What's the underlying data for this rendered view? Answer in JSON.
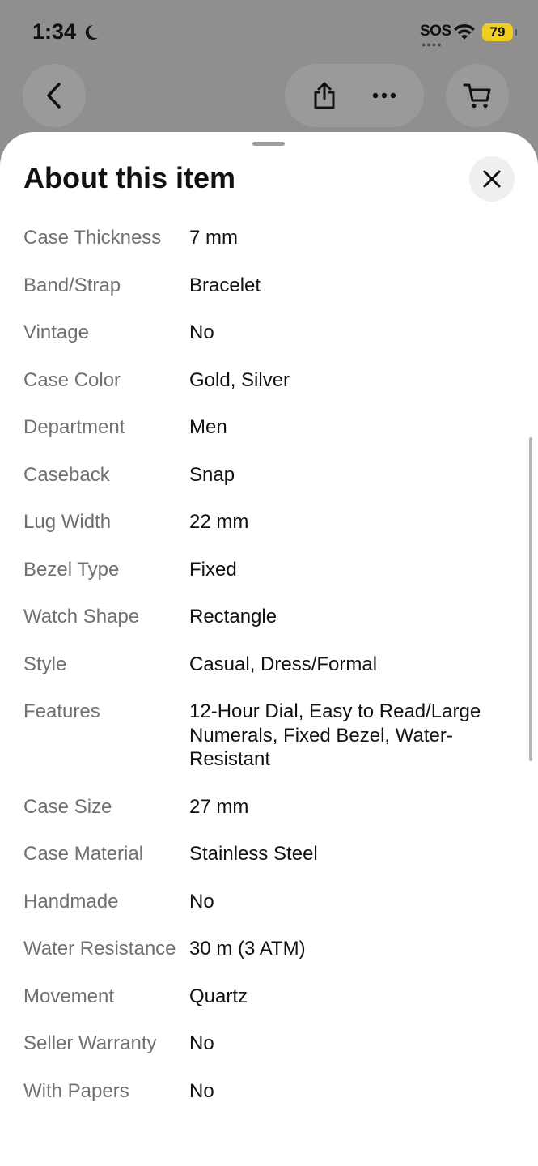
{
  "status_bar": {
    "time": "1:34",
    "sos": "SOS",
    "battery": "79"
  },
  "sheet": {
    "title": "About this item"
  },
  "specs": [
    {
      "label": "Case Thickness",
      "value": "7 mm"
    },
    {
      "label": "Band/Strap",
      "value": "Bracelet"
    },
    {
      "label": "Vintage",
      "value": "No"
    },
    {
      "label": "Case Color",
      "value": "Gold, Silver"
    },
    {
      "label": "Department",
      "value": "Men"
    },
    {
      "label": "Caseback",
      "value": "Snap"
    },
    {
      "label": "Lug Width",
      "value": "22 mm"
    },
    {
      "label": "Bezel Type",
      "value": "Fixed"
    },
    {
      "label": "Watch Shape",
      "value": "Rectangle"
    },
    {
      "label": "Style",
      "value": "Casual, Dress/Formal"
    },
    {
      "label": "Features",
      "value": "12-Hour Dial, Easy to Read/Large Numerals, Fixed Bezel, Water-Resistant"
    },
    {
      "label": "Case Size",
      "value": "27 mm"
    },
    {
      "label": "Case Material",
      "value": "Stainless Steel"
    },
    {
      "label": "Handmade",
      "value": "No"
    },
    {
      "label": "Water Resistance",
      "value": "30 m (3 ATM)"
    },
    {
      "label": "Movement",
      "value": "Quartz"
    },
    {
      "label": "Seller Warranty",
      "value": "No"
    },
    {
      "label": "With Papers",
      "value": "No"
    }
  ],
  "icons": {
    "back": "chevron-left-icon",
    "share": "share-icon",
    "more": "more-horizontal-icon",
    "cart": "cart-icon",
    "close": "close-icon"
  },
  "colors": {
    "battery": "#f2cf1e",
    "overlay": "#8f8f8f",
    "label_text": "#707070"
  }
}
